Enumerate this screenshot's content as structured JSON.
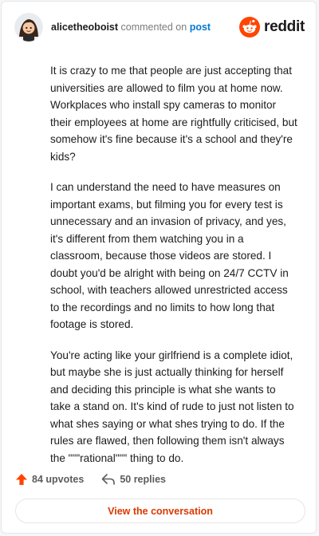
{
  "header": {
    "username": "alicetheoboist",
    "commented_on_text": "commented on",
    "post_link": "post",
    "brand_name": "reddit",
    "avatar_icon": "avatar-icon",
    "brand_icon": "reddit-snoo-icon"
  },
  "comment": {
    "paragraphs": [
      "It is crazy to me that people are just accepting that universities are allowed to film you at home now. Workplaces who install spy cameras to monitor their employees at home are rightfully criticised, but somehow it's fine because it's a school and they're kids?",
      "I can understand the need to have measures on important exams, but filming you for every test is unnecessary and an invasion of privacy, and yes, it's different from them watching you in a classroom, because those videos are stored. I doubt you'd be alright with being on 24/7 CCTV in school, with teachers allowed unrestricted access to the recordings and no limits to how long that footage is stored.",
      "You're acting like your girlfriend is a complete idiot, but maybe she is just actually thinking for herself and deciding this principle is what she wants to take a stand on. It's kind of rude to just not listen to what shes saying or what shes trying to do. If the rules are flawed, then following them isn't always the \"\"\"rational\"\"\" thing to do."
    ]
  },
  "footer": {
    "upvotes": "84 upvotes",
    "replies": "50 replies",
    "upvote_icon": "upvote-arrow-icon",
    "reply_icon": "reply-arrow-icon",
    "view_button": "View the conversation"
  },
  "colors": {
    "brand_orange": "#ff4500",
    "link_blue": "#0079d3",
    "button_text": "#d93a00"
  }
}
